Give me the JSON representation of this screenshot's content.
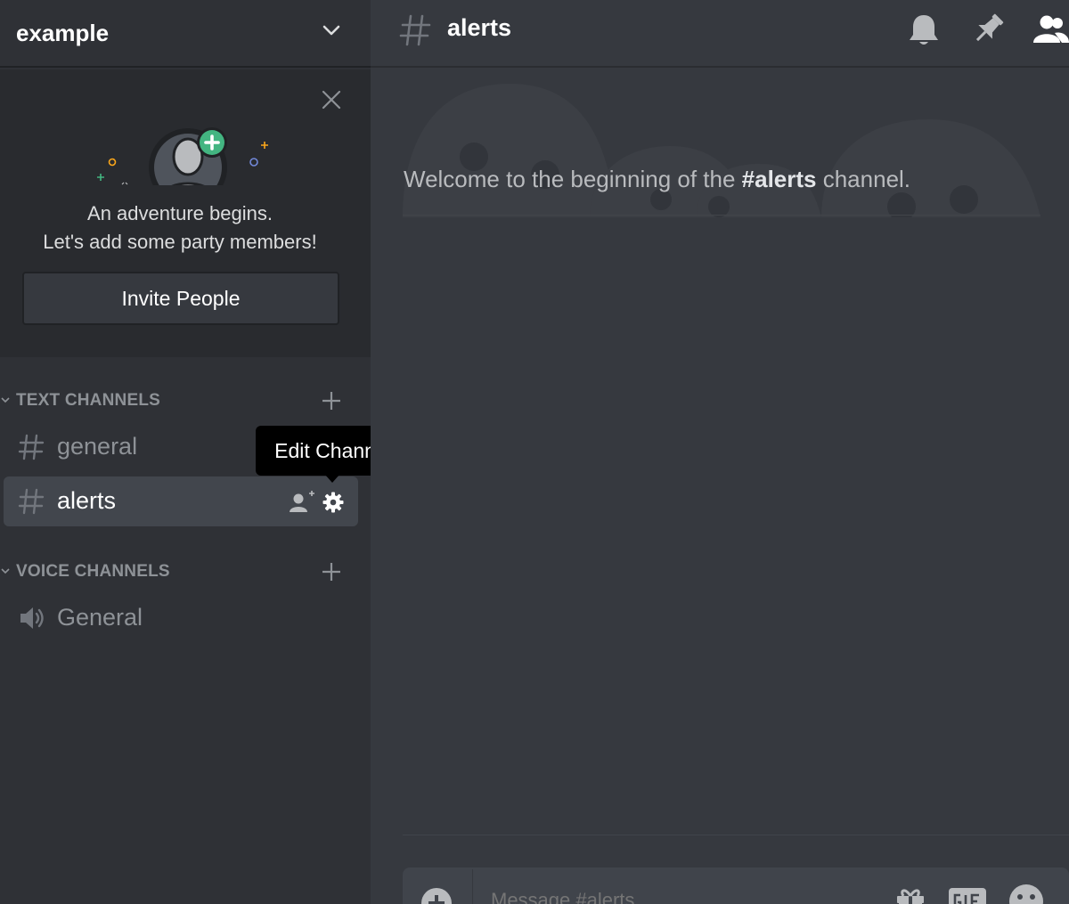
{
  "server": {
    "name": "example"
  },
  "invite_panel": {
    "line1": "An adventure begins.",
    "line2": "Let's add some party members!",
    "button_label": "Invite People"
  },
  "categories": [
    {
      "label": "TEXT CHANNELS"
    },
    {
      "label": "VOICE CHANNELS"
    }
  ],
  "channels": [
    {
      "name": "general",
      "type": "text",
      "active": false
    },
    {
      "name": "alerts",
      "type": "text",
      "active": true
    },
    {
      "name": "General",
      "type": "voice",
      "active": false
    }
  ],
  "tooltip": {
    "text": "Edit Channel"
  },
  "main": {
    "channel_title": "alerts",
    "welcome_prefix": "Welcome to the beginning of the ",
    "welcome_channel": "#alerts",
    "welcome_suffix": " channel.",
    "composer_placeholder": "Message #alerts"
  },
  "icons": {
    "header": [
      "bell-icon",
      "pin-icon",
      "members-icon"
    ],
    "composer": [
      "upload-icon",
      "gift-icon",
      "gif-icon",
      "emoji-icon"
    ]
  },
  "colors": {
    "sidebar_bg": "#2f3136",
    "main_bg": "#36393f",
    "accent_green": "#43b581",
    "tooltip_bg": "#000000"
  }
}
